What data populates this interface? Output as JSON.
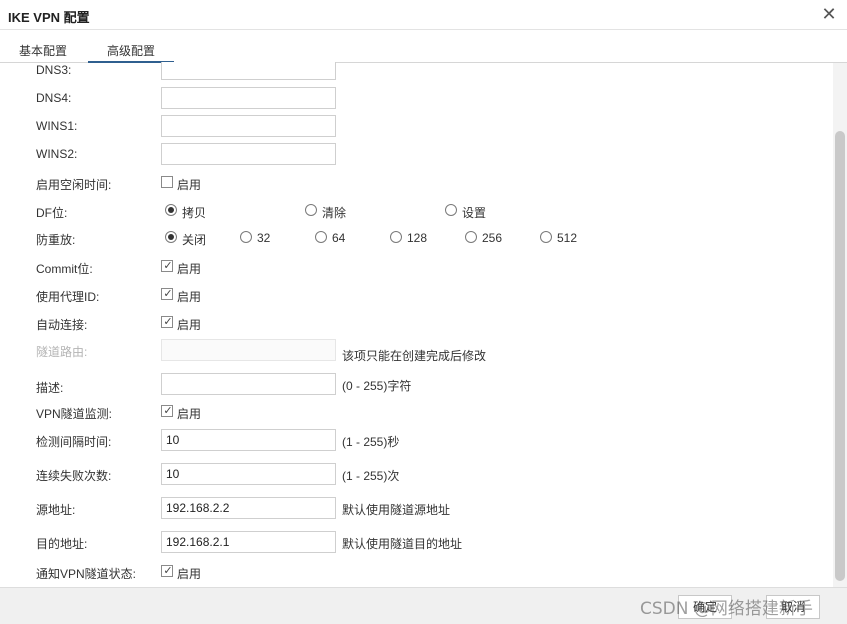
{
  "window": {
    "title": "IKE VPN 配置",
    "close_glyph": "✕"
  },
  "tabs": [
    {
      "label": "基本配置"
    },
    {
      "label": "高级配置"
    }
  ],
  "form": {
    "dns3": {
      "label": "DNS3:",
      "value": ""
    },
    "dns4": {
      "label": "DNS4:",
      "value": ""
    },
    "wins1": {
      "label": "WINS1:",
      "value": ""
    },
    "wins2": {
      "label": "WINS2:",
      "value": ""
    },
    "idle_time": {
      "label": "启用空闲时间:",
      "checkbox_label": "启用",
      "checked": false
    },
    "df_bit": {
      "label": "DF位:",
      "options": [
        "拷贝",
        "清除",
        "设置"
      ],
      "selected": "拷贝"
    },
    "anti_replay": {
      "label": "防重放:",
      "options": [
        "关闭",
        "32",
        "64",
        "128",
        "256",
        "512"
      ],
      "selected": "关闭"
    },
    "commit_bit": {
      "label": "Commit位:",
      "checkbox_label": "启用",
      "checked": true
    },
    "use_proxy_id": {
      "label": "使用代理ID:",
      "checkbox_label": "启用",
      "checked": true
    },
    "auto_connect": {
      "label": "自动连接:",
      "checkbox_label": "启用",
      "checked": true
    },
    "tunnel_route": {
      "label": "隧道路由:",
      "value": "",
      "hint": "该项只能在创建完成后修改"
    },
    "description": {
      "label": "描述:",
      "value": "",
      "hint": "(0 - 255)字符"
    },
    "vpn_monitor": {
      "label": "VPN隧道监测:",
      "checkbox_label": "启用",
      "checked": true
    },
    "check_interval": {
      "label": "检测间隔时间:",
      "value": "10",
      "hint": "(1 - 255)秒"
    },
    "fail_count": {
      "label": "连续失败次数:",
      "value": "10",
      "hint": "(1 - 255)次"
    },
    "src_addr": {
      "label": "源地址:",
      "value": "192.168.2.2",
      "hint": "默认使用隧道源地址"
    },
    "dst_addr": {
      "label": "目的地址:",
      "value": "192.168.2.1",
      "hint": "默认使用隧道目的地址"
    },
    "notify_state": {
      "label": "通知VPN隧道状态:",
      "checkbox_label": "启用",
      "checked": true
    }
  },
  "footer": {
    "ok_label": "确定",
    "cancel_label": "取消"
  },
  "watermark": "CSDN @网络搭建新手",
  "check_glyph": "✓"
}
